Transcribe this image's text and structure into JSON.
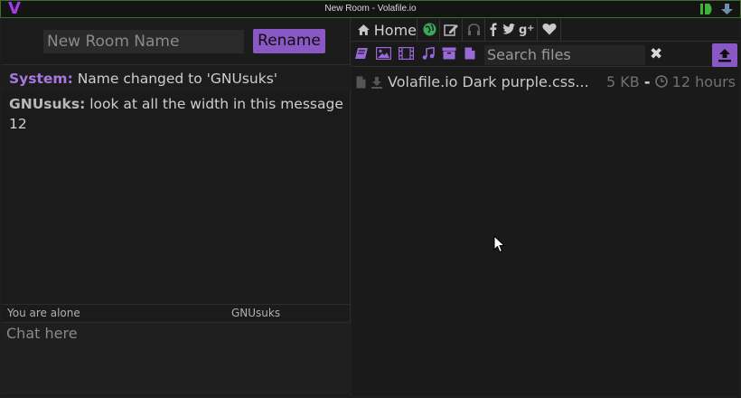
{
  "window": {
    "title": "New Room - Volafile.io",
    "logo": "V"
  },
  "left": {
    "room_name_placeholder": "New Room Name",
    "rename_label": "Rename",
    "messages": [
      {
        "nick": "System:",
        "text": " Name changed to 'GNUsuks'",
        "kind": "system"
      },
      {
        "nick": "GNUsuks:",
        "text": " look at all the width in this message 12",
        "kind": "user"
      }
    ],
    "status": "You are alone",
    "current_nick": "GNUsuks",
    "chat_placeholder": "Chat here"
  },
  "right": {
    "home_label": "Home",
    "search_placeholder": "Search files",
    "clear_label": "✖",
    "files": [
      {
        "name": "Volafile.io Dark purple.css...",
        "size": "5 KB",
        "sep": "-",
        "age": "12 hours"
      }
    ]
  },
  "icons": {
    "home": "home-icon",
    "globe": "globe-icon",
    "edit": "edit-icon",
    "headphones": "headphones-icon",
    "facebook": "facebook-icon",
    "twitter": "twitter-icon",
    "googleplus": "googleplus-icon",
    "heart": "heart-icon"
  },
  "colors": {
    "accent": "#8a58c4",
    "system_nick": "#a878e0",
    "globe": "#3aa85a"
  }
}
